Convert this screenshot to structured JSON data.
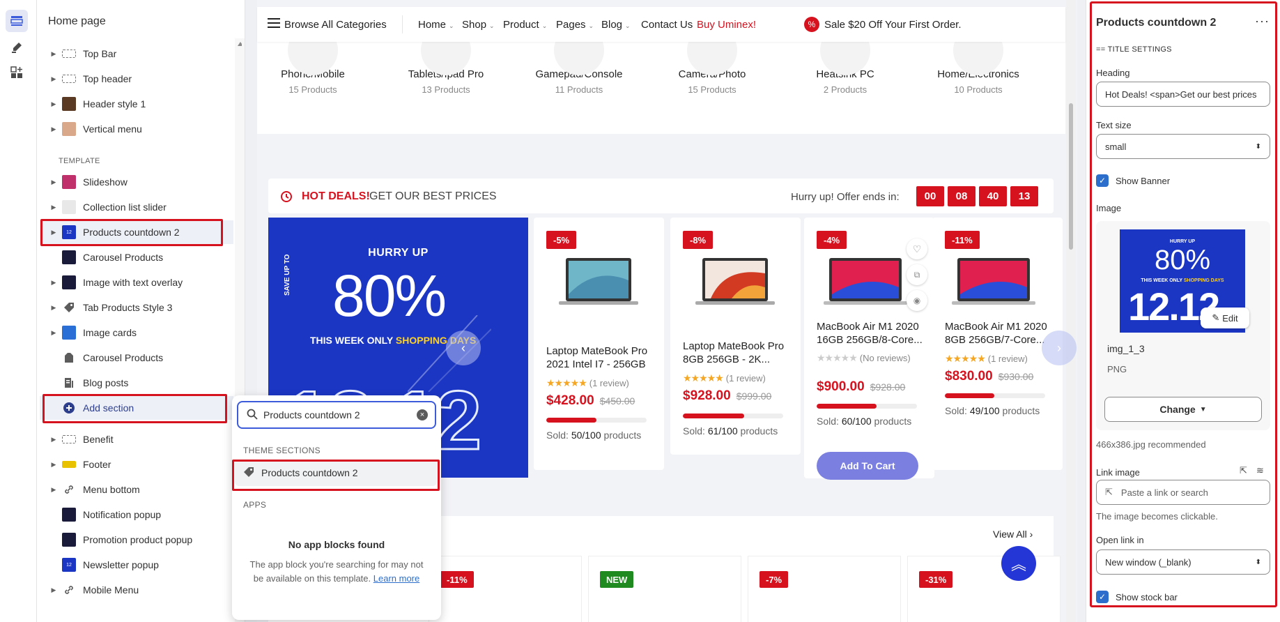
{
  "sidebar": {
    "title": "Home page",
    "template_label": "TEMPLATE",
    "items": [
      {
        "label": "Top Bar"
      },
      {
        "label": "Top header"
      },
      {
        "label": "Header style 1"
      },
      {
        "label": "Vertical menu"
      },
      {
        "label": "Slideshow"
      },
      {
        "label": "Collection list slider"
      },
      {
        "label": "Products countdown 2"
      },
      {
        "label": "Carousel Products"
      },
      {
        "label": "Image with text overlay"
      },
      {
        "label": "Tab Products Style 3"
      },
      {
        "label": "Image cards"
      },
      {
        "label": "Carousel Products"
      },
      {
        "label": "Blog posts"
      },
      {
        "label": "Add section"
      },
      {
        "label": "Benefit"
      },
      {
        "label": "Footer"
      },
      {
        "label": "Menu bottom"
      },
      {
        "label": "Notification popup"
      },
      {
        "label": "Promotion product popup"
      },
      {
        "label": "Newsletter popup"
      },
      {
        "label": "Mobile Menu"
      }
    ]
  },
  "popup": {
    "search_value": "Products countdown 2",
    "theme_sections_label": "THEME SECTIONS",
    "result": "Products countdown 2",
    "apps_label": "APPS",
    "no_apps": "No app blocks found",
    "note": "The app block you're searching for may not be available on this template.",
    "learn_more": "Learn more"
  },
  "preview": {
    "nav": {
      "browse": "Browse All Categories",
      "items": [
        "Home",
        "Shop",
        "Product",
        "Pages",
        "Blog"
      ],
      "contact": "Contact Us",
      "buy": "Buy Uminex!",
      "sale": "Sale $20 Off Your First Order."
    },
    "categories": [
      {
        "name": "Phone/Mobile",
        "count": "15 Products"
      },
      {
        "name": "Tablets/Ipad Pro",
        "count": "13 Products"
      },
      {
        "name": "Gamepad/Console",
        "count": "11 Products"
      },
      {
        "name": "Camera/Photo",
        "count": "15 Products"
      },
      {
        "name": "Heatsink PC",
        "count": "2 Products"
      },
      {
        "name": "Home/Electronics",
        "count": "10 Products"
      }
    ],
    "hot": {
      "title_red": "HOT DEALS!",
      "title_rest": "GET OUR BEST PRICES",
      "ends": "Hurry up! Offer ends in:",
      "countdown": [
        "00",
        "08",
        "40",
        "13"
      ]
    },
    "banner": {
      "hurry": "HURRY UP",
      "save": "SAVE UP TO",
      "pct": "80%",
      "week": "THIS WEEK ONLY",
      "shopping": "SHOPPING DAYS",
      "date": "12.12"
    },
    "products": [
      {
        "discount": "-5%",
        "name": "Laptop MateBook Pro 2021 Intel I7 - 256GB",
        "stars": "★★★★★",
        "reviews": "(1 review)",
        "price": "$428.00",
        "old": "$450.00",
        "sold_label": "Sold:",
        "sold": "50/100",
        "sold_unit": "products",
        "sold_fraction": 0.5
      },
      {
        "discount": "-8%",
        "name": "Laptop MateBook Pro 8GB 256GB - 2K...",
        "stars": "★★★★★",
        "reviews": "(1 review)",
        "price": "$928.00",
        "old": "$999.00",
        "sold_label": "Sold:",
        "sold": "61/100",
        "sold_unit": "products",
        "sold_fraction": 0.61
      },
      {
        "discount": "-4%",
        "name": "MacBook Air M1 2020 16GB 256GB/8-Core...",
        "stars": "★★★★★",
        "reviews": "(No reviews)",
        "price": "$900.00",
        "old": "$928.00",
        "sold_label": "Sold:",
        "sold": "60/100",
        "sold_unit": "products",
        "sold_fraction": 0.6,
        "button": "Add To Cart"
      },
      {
        "discount": "-11%",
        "name": "MacBook Air M1 2020 8GB 256GB/7-Core...",
        "stars": "★★★★★",
        "reviews": "(1 review)",
        "price": "$830.00",
        "old": "$930.00",
        "sold_label": "Sold:",
        "sold": "49/100",
        "sold_unit": "products",
        "sold_fraction": 0.49
      }
    ],
    "view_all": "View All",
    "small_cards": [
      "-11%",
      "NEW",
      "-7%",
      "-31%"
    ]
  },
  "panel": {
    "title": "Products countdown 2",
    "more": "···",
    "subtitle": "== TITLE SETTINGS",
    "heading_label": "Heading",
    "heading_value": "Hot Deals! <span>Get our best prices",
    "text_size_label": "Text size",
    "text_size_value": "small",
    "show_banner": "Show Banner",
    "image_label": "Image",
    "edit": "Edit",
    "image_name": "img_1_3",
    "image_type": "PNG",
    "change": "Change",
    "recommend": "466x386.jpg recommended",
    "link_label": "Link image",
    "link_placeholder": "Paste a link or search",
    "link_hint": "The image becomes clickable.",
    "open_label": "Open link in",
    "open_value": "New window (_blank)",
    "stock_bar": "Show stock bar"
  },
  "colors": {
    "accent": "#d6121f",
    "brand_blue": "#1c36c4",
    "checkbox": "#2c6ecb"
  }
}
